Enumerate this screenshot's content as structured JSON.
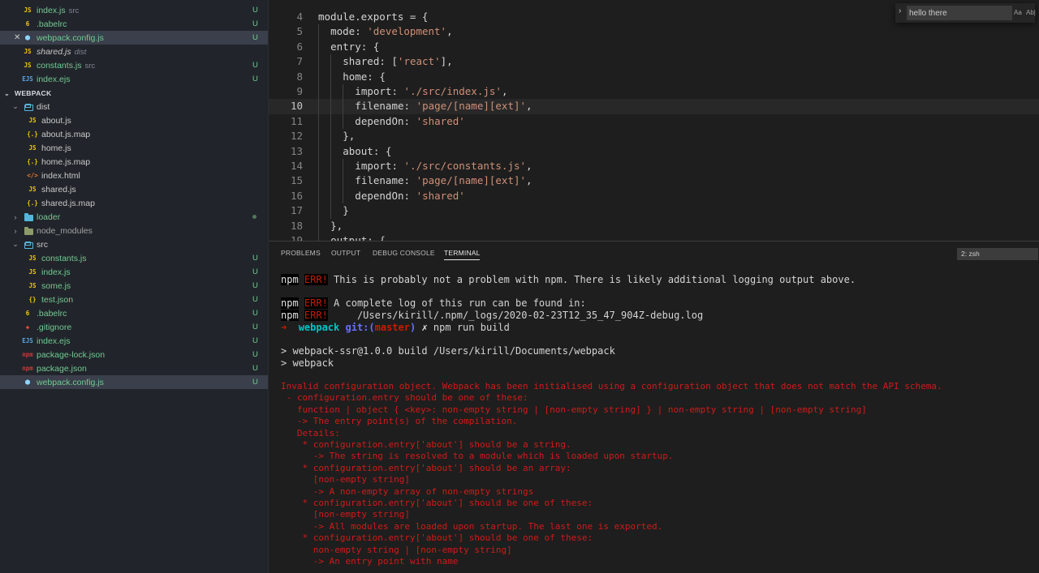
{
  "sidebar": {
    "open_editors": [
      {
        "name": "index.js",
        "desc": "src",
        "icon": "js-file-icon",
        "icon_text": "JS",
        "status": "U"
      },
      {
        "name": ".babelrc",
        "desc": "",
        "icon": "babel-file-icon",
        "icon_text": "6",
        "status": "U"
      },
      {
        "name": "webpack.config.js",
        "desc": "",
        "icon": "webpack-file-icon",
        "icon_text": "⬢",
        "status": "U",
        "selected": true,
        "close": "✕"
      },
      {
        "name": "shared.js",
        "desc": "dist",
        "icon": "js-file-icon",
        "icon_text": "JS",
        "status": ""
      },
      {
        "name": "constants.js",
        "desc": "src",
        "icon": "js-file-icon",
        "icon_text": "JS",
        "status": "U"
      },
      {
        "name": "index.ejs",
        "desc": "",
        "icon": "ejs-file-icon",
        "icon_text": "EJS",
        "status": "U"
      }
    ],
    "section_title": "WEBPACK",
    "tree": [
      {
        "name": "dist",
        "kind": "folder",
        "open": true,
        "level": 1,
        "status": ""
      },
      {
        "name": "about.js",
        "kind": "js",
        "level": 2,
        "status": ""
      },
      {
        "name": "about.js.map",
        "kind": "map",
        "level": 2,
        "status": ""
      },
      {
        "name": "home.js",
        "kind": "js",
        "level": 2,
        "status": ""
      },
      {
        "name": "home.js.map",
        "kind": "map",
        "level": 2,
        "status": ""
      },
      {
        "name": "index.html",
        "kind": "html",
        "level": 2,
        "status": ""
      },
      {
        "name": "shared.js",
        "kind": "js",
        "level": 2,
        "status": ""
      },
      {
        "name": "shared.js.map",
        "kind": "map",
        "level": 2,
        "status": ""
      },
      {
        "name": "loader",
        "kind": "folder",
        "open": false,
        "level": 1,
        "status": "dot"
      },
      {
        "name": "node_modules",
        "kind": "folder-nm",
        "open": false,
        "level": 1,
        "status": ""
      },
      {
        "name": "src",
        "kind": "folder",
        "open": true,
        "level": 1,
        "status": ""
      },
      {
        "name": "constants.js",
        "kind": "js",
        "level": 2,
        "status": "U"
      },
      {
        "name": "index.js",
        "kind": "js",
        "level": 2,
        "status": "U"
      },
      {
        "name": "some.js",
        "kind": "js",
        "level": 2,
        "status": "U"
      },
      {
        "name": "test.json",
        "kind": "json",
        "level": 2,
        "status": "U"
      },
      {
        "name": ".babelrc",
        "kind": "babel",
        "level": 1,
        "status": "U"
      },
      {
        "name": ".gitignore",
        "kind": "git",
        "level": 1,
        "status": "U"
      },
      {
        "name": "index.ejs",
        "kind": "ejs",
        "level": 1,
        "status": "U"
      },
      {
        "name": "package-lock.json",
        "kind": "npm",
        "level": 1,
        "status": "U"
      },
      {
        "name": "package.json",
        "kind": "npm",
        "level": 1,
        "status": "U"
      },
      {
        "name": "webpack.config.js",
        "kind": "webpack",
        "level": 1,
        "status": "U",
        "selected": true
      }
    ]
  },
  "editor": {
    "lines": [
      {
        "n": "4",
        "text": "module.exports = {",
        "indent": 0
      },
      {
        "n": "5",
        "text": "mode: 'development',",
        "indent": 1
      },
      {
        "n": "6",
        "text": "entry: {",
        "indent": 1
      },
      {
        "n": "7",
        "text": "shared: ['react'],",
        "indent": 2
      },
      {
        "n": "8",
        "text": "home: {",
        "indent": 2
      },
      {
        "n": "9",
        "text": "import: './src/index.js',",
        "indent": 3
      },
      {
        "n": "10",
        "text": "filename: 'page/[name][ext]',",
        "indent": 3,
        "current": true
      },
      {
        "n": "11",
        "text": "dependOn: 'shared'",
        "indent": 3
      },
      {
        "n": "12",
        "text": "},",
        "indent": 2
      },
      {
        "n": "13",
        "text": "about: {",
        "indent": 2
      },
      {
        "n": "14",
        "text": "import: './src/constants.js',",
        "indent": 3
      },
      {
        "n": "15",
        "text": "filename: 'page/[name][ext]',",
        "indent": 3
      },
      {
        "n": "16",
        "text": "dependOn: 'shared'",
        "indent": 3
      },
      {
        "n": "17",
        "text": "}",
        "indent": 2
      },
      {
        "n": "18",
        "text": "},",
        "indent": 1
      },
      {
        "n": "19",
        "text": "output: {",
        "indent": 1
      }
    ],
    "find": {
      "value": "hello there",
      "match_case": "Aa",
      "whole_word": "Ab|"
    }
  },
  "panel": {
    "tabs": [
      "PROBLEMS",
      "OUTPUT",
      "DEBUG CONSOLE",
      "TERMINAL"
    ],
    "active_tab": "TERMINAL",
    "terminal_select": "2: zsh",
    "terminal": {
      "npm": "npm",
      "err": "ERR!",
      "line1": " This is probably not a problem with npm. There is likely additional logging output above.",
      "line2": " A complete log of this run can be found in:",
      "line3": "     /Users/kirill/.npm/_logs/2020-02-23T12_35_47_904Z-debug.log",
      "prompt_arrow": "➜",
      "prompt_dir": "webpack",
      "prompt_git": "git:(",
      "prompt_branch": "master",
      "prompt_git_close": ")",
      "prompt_x": "✗",
      "prompt_cmd": "npm run build",
      "build1": "> webpack-ssr@1.0.0 build /Users/kirill/Documents/webpack",
      "build2": "> webpack",
      "error_lines": [
        "Invalid configuration object. Webpack has been initialised using a configuration object that does not match the API schema.",
        " - configuration.entry should be one of these:",
        "   function | object { <key>: non-empty string | [non-empty string] } | non-empty string | [non-empty string]",
        "   -> The entry point(s) of the compilation.",
        "   Details:",
        "    * configuration.entry['about'] should be a string.",
        "      -> The string is resolved to a module which is loaded upon startup.",
        "    * configuration.entry['about'] should be an array:",
        "      [non-empty string]",
        "      -> A non-empty array of non-empty strings",
        "    * configuration.entry['about'] should be one of these:",
        "      [non-empty string]",
        "      -> All modules are loaded upon startup. The last one is exported.",
        "    * configuration.entry['about'] should be one of these:",
        "      non-empty string | [non-empty string]",
        "      -> An entry point with name"
      ]
    }
  }
}
